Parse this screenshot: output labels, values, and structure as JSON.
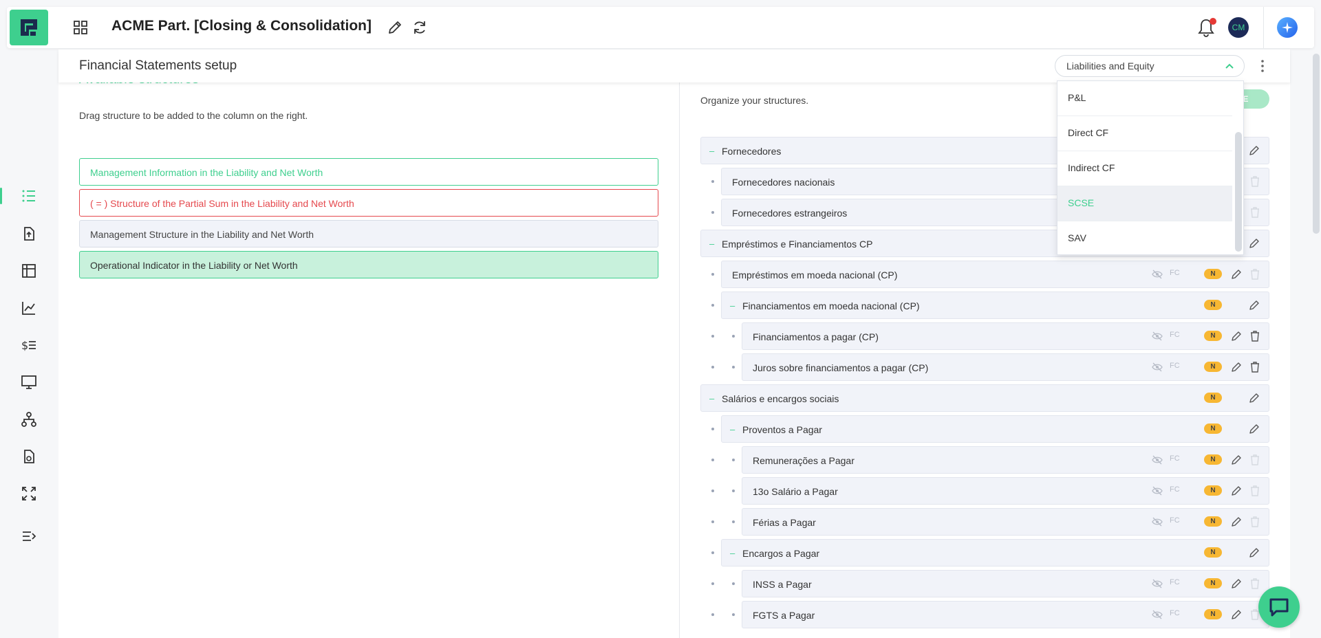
{
  "topbar": {
    "title": "ACME Part. [Closing & Consolidation]",
    "avatar_initials": "CM",
    "has_notification": true
  },
  "nav": {
    "active_item": "structures",
    "items": [
      "structures",
      "upload",
      "ledger",
      "analytics",
      "finance-list",
      "monitor",
      "org-tree",
      "report",
      "expand",
      "collapse-menu"
    ]
  },
  "page": {
    "title": "Financial Statements setup",
    "selector": {
      "value": "Liabilities and Equity",
      "options": [
        "P&L",
        "Direct CF",
        "Indirect CF",
        "SCSE",
        "SAV"
      ],
      "highlighted": "SCSE"
    }
  },
  "available": {
    "title": "Available structures",
    "hint": "Drag structure to be added to the column on the right.",
    "items": [
      "Management Information in the Liability and Net Worth",
      "( = ) Structure of the Partial Sum in the Liability and Net Worth",
      "Management Structure in the Liability and Net Worth",
      "Operational Indicator in the Liability or Net Worth"
    ]
  },
  "organize": {
    "hint": "Organize your structures.",
    "add_button": "URE",
    "badge": "N",
    "fc": "FC",
    "rows": [
      {
        "label": "Fornecedores",
        "level": 0,
        "type": "group"
      },
      {
        "label": "Fornecedores nacionais",
        "level": 1,
        "type": "leaf"
      },
      {
        "label": "Fornecedores estrangeiros",
        "level": 1,
        "type": "leaf"
      },
      {
        "label": "Empréstimos e Financiamentos CP",
        "level": 0,
        "type": "group"
      },
      {
        "label": "Empréstimos em moeda nacional (CP)",
        "level": 1,
        "type": "leaf"
      },
      {
        "label": "Financiamentos em moeda nacional (CP)",
        "level": 1,
        "type": "group"
      },
      {
        "label": "Financiamentos a pagar (CP)",
        "level": 2,
        "type": "leaf"
      },
      {
        "label": "Juros sobre financiamentos a pagar (CP)",
        "level": 2,
        "type": "leaf"
      },
      {
        "label": "Salários e encargos sociais",
        "level": 0,
        "type": "group"
      },
      {
        "label": "Proventos a Pagar",
        "level": 1,
        "type": "group"
      },
      {
        "label": "Remunerações a Pagar",
        "level": 2,
        "type": "leaf"
      },
      {
        "label": "13o Salário a Pagar",
        "level": 2,
        "type": "leaf"
      },
      {
        "label": "Férias a Pagar",
        "level": 2,
        "type": "leaf"
      },
      {
        "label": "Encargos a Pagar",
        "level": 1,
        "type": "group"
      },
      {
        "label": "INSS a Pagar",
        "level": 2,
        "type": "leaf"
      },
      {
        "label": "FGTS a Pagar",
        "level": 2,
        "type": "leaf"
      }
    ]
  },
  "colors": {
    "accent": "#3ecf8e",
    "danger": "#e5484d",
    "badge": "#f7b733",
    "navy": "#1c2a57"
  }
}
